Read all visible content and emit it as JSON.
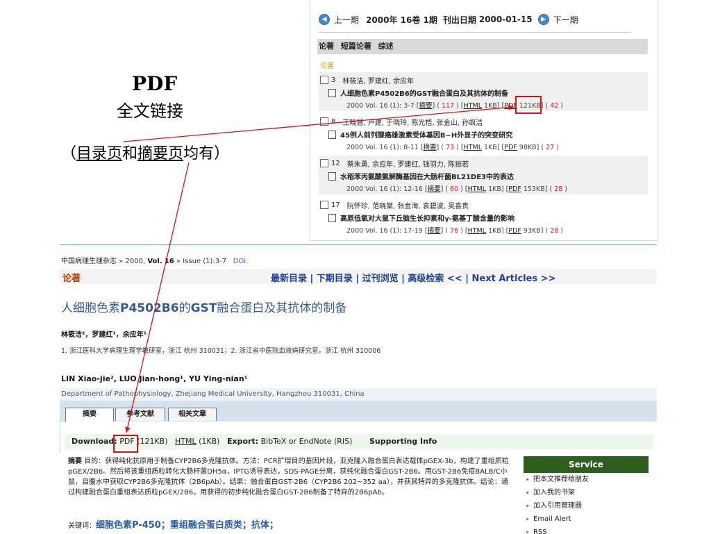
{
  "toc": {
    "prev": "上一期",
    "issue": "2000年 16卷 1期",
    "pub_date_label": "刊出日期",
    "pub_date": "2000-01-15",
    "next": "下一期",
    "tabs": [
      "论著",
      "短篇论著",
      "综述"
    ],
    "section": "论著",
    "articles": [
      {
        "num": "3",
        "authors": "林筱洁, 罗建红, 余应年",
        "title": "人细胞色素P4502B6的GST融合蛋白及其抗体的制备",
        "cite": "2000 Vol. 16 (1): 3-7",
        "abs": "摘要",
        "count": "117",
        "html": "HTML",
        "html_size": "1KB",
        "pdf": "PDF",
        "pdf_size": "121KB",
        "pdf_count": "42"
      },
      {
        "num": "8",
        "authors": "王晓慧, 卢建, 于晓玲, 陈光梧, 张金山, 孙飒洁",
        "title": "45例人前列腺癌雄激素受体基因B~H外显子的突变研究",
        "cite": "2000 Vol. 16 (1): 8-11",
        "abs": "摘要",
        "count": "73",
        "html": "HTML",
        "html_size": "1KB",
        "pdf": "PDF",
        "pdf_size": "98KB",
        "pdf_count": "27"
      },
      {
        "num": "12",
        "authors": "蔡朱勇, 余应年, 罗建红, 钱羽力, 陈振若",
        "title": "水稻苯丙氨酸氨解酶基因在大肠杆菌BL21DE3中的表达",
        "cite": "2000 Vol. 16 (1): 12-16",
        "abs": "摘要",
        "count": "60",
        "html": "HTML",
        "html_size": "1KB",
        "pdf": "PDF",
        "pdf_size": "153KB",
        "pdf_count": "28"
      },
      {
        "num": "17",
        "authors": "阮怀珍, 范晓棠, 张金海, 袁碧波, 吴喜贵",
        "title": "高原低氧对大鼠下丘脑生长抑素和γ-氨基丁酸含量的影响",
        "cite": "2000 Vol. 16 (1): 17-19",
        "abs": "摘要",
        "count": "76",
        "html": "HTML",
        "html_size": "1KB",
        "pdf": "PDF",
        "pdf_size": "93KB",
        "pdf_count": "28"
      }
    ]
  },
  "annotation": {
    "pdf": "PDF",
    "fulltext": "全文链接",
    "note_open": "（",
    "note_toc": "目录页",
    "note_and": "和",
    "note_abs": "摘要页",
    "note_tail": "均有）",
    "arrow_color": "#e01010"
  },
  "article_page": {
    "breadcrumb": {
      "journal": "中国病理生理杂志",
      "sep1": "»",
      "year": "2000,",
      "vol_label": "Vol.",
      "vol": "16",
      "sep2": "»",
      "issue": "Issue (1)",
      "pages": ":3-7",
      "doi": "DOI:"
    },
    "section": "论著",
    "nav": "最新目录 | 下期目录 | 过刊浏览 | 高级检索    << | Next Articles >>",
    "title_pre": "人细胞色素",
    "title_bold1": "P4502B6",
    "title_mid": "的",
    "title_bold2": "GST",
    "title_post": "融合蛋白及其抗体的制备",
    "authors_cn": "林筱洁²，罗建红¹，余应年¹",
    "affil": "1. 浙江医科大学病理生理学教研室，浙江 杭州 310031；2. 浙江省中医院血液病研究室，浙江 杭州 310006",
    "authors_en": "LIN Xiao-jie², LUO Jian-hong¹, YU Ying-nian¹",
    "dept": "Department of Pathophysiology, Zhejiang Medical University, Hangzhou 310031, China",
    "tabs": [
      "摘要",
      "参考文献",
      "相关文章"
    ],
    "download_label": "Download:",
    "dl_pdf": "PDF",
    "dl_pdf_size": "(121KB)",
    "dl_html": "HTML",
    "dl_html_size": "(1KB)",
    "export_label": "Export:",
    "export_value": "BibTeX or EndNote (RIS)",
    "supporting": "Supporting Info",
    "abstract_label": "摘要",
    "abstract": "目的：获得纯化抗原用于制备CYP2B6多克隆抗体。方法：PCR扩增目的基因片段，亚克隆入融合蛋白表达载体pGEX-3b，构建了重组质粒pGEX/2B6。然后将该重组质粒转化大肠杆菌DH5α，IPTG诱导表达，SDS-PAGE分离，获纯化融合蛋白GST-2B6。用GST-2B6免疫BALB/C小鼠，自腹水中获取CYP2B6多克隆抗体（2B6pAb）。结果：融合蛋白GST-2B6（CYP2B6 202~352 aa），并获其特异的多克隆抗体。结论：通过构建融合蛋白重组表达质粒pGEX/2B6，用获得的初步纯化融合蛋白GST-2B6制备了特异的2B6pAb。",
    "keywords_label": "关键词：",
    "keywords": "细胞色素P-450；重组融合蛋白质类；抗体；",
    "service": {
      "title": "Service",
      "items": [
        "把本文推荐给朋友",
        "加入我的书架",
        "加入引用管理器",
        "Email Alert",
        "RSS"
      ]
    }
  }
}
